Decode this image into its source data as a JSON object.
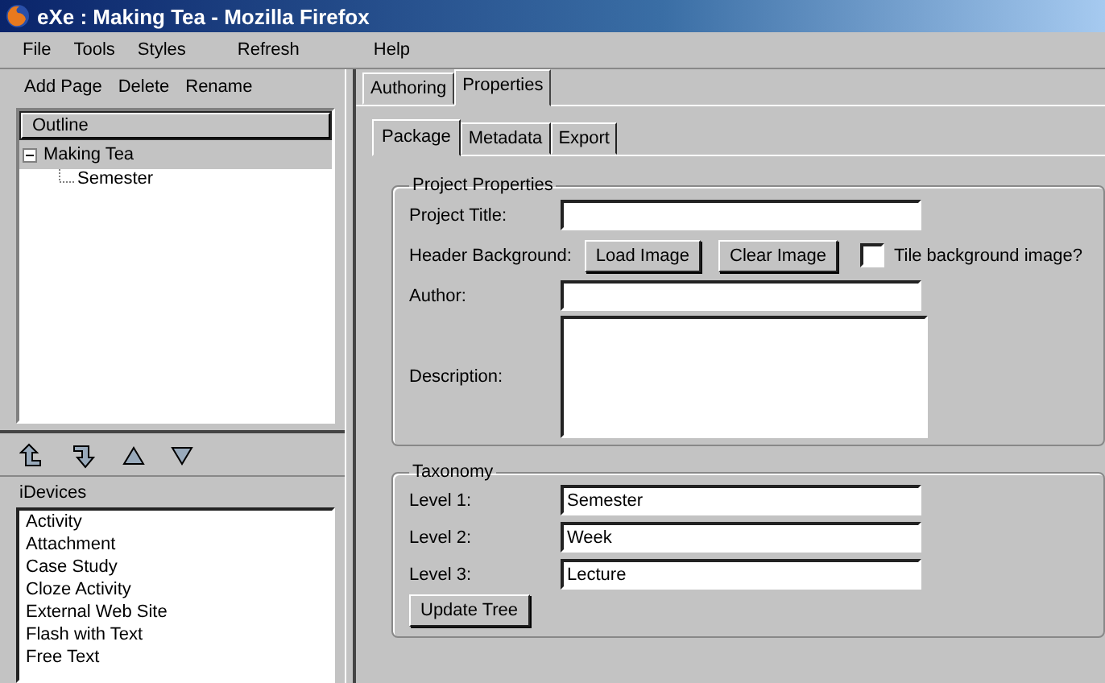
{
  "window": {
    "title": "eXe : Making Tea - Mozilla Firefox"
  },
  "menu": [
    {
      "label": "File"
    },
    {
      "label": "Tools"
    },
    {
      "label": "Styles"
    },
    {
      "label": "Refresh"
    },
    {
      "label": "Help"
    }
  ],
  "outline_toolbar": [
    "Add Page",
    "Delete",
    "Rename"
  ],
  "outline": {
    "header": "Outline",
    "nodes": [
      {
        "label": "Making Tea",
        "selected": true,
        "expanded": true,
        "children": [
          {
            "label": "Semester",
            "selected": false
          }
        ]
      }
    ]
  },
  "idevices": {
    "header": "iDevices",
    "items": [
      "Activity",
      "Attachment",
      "Case Study",
      "Cloze Activity",
      "External Web Site",
      "Flash with Text",
      "Free Text"
    ]
  },
  "tabs": [
    {
      "label": "Authoring",
      "selected": false
    },
    {
      "label": "Properties",
      "selected": true
    }
  ],
  "subtabs": [
    {
      "label": "Package",
      "selected": true
    },
    {
      "label": "Metadata",
      "selected": false
    },
    {
      "label": "Export",
      "selected": false
    }
  ],
  "project_properties": {
    "legend": "Project Properties",
    "project_title_label": "Project Title:",
    "header_background_label": "Header Background:",
    "load_image": "Load Image",
    "clear_image": "Clear Image",
    "tile_label": "Tile background image?",
    "tile_checked": false,
    "author_label": "Author:",
    "description_label": "Description:"
  },
  "taxonomy": {
    "legend": "Taxonomy",
    "levels": [
      {
        "label": "Level 1:",
        "value": "Semester"
      },
      {
        "label": "Level 2:",
        "value": "Week"
      },
      {
        "label": "Level 3:",
        "value": "Lecture"
      }
    ],
    "update_button": "Update Tree"
  }
}
